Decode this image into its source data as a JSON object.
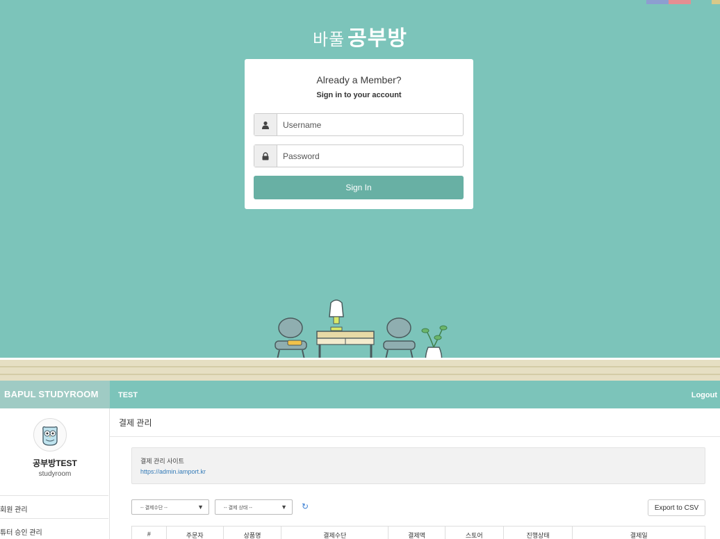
{
  "login": {
    "brand_prefix": "바풀",
    "brand_main": "공부방",
    "heading": "Already a Member?",
    "subheading": "Sign in to your account",
    "username_placeholder": "Username",
    "password_placeholder": "Password",
    "signin_label": "Sign In"
  },
  "colors": {
    "scene_bg": "#7cc4ba",
    "button_bg": "#68b0a4",
    "swatch_1": "#8d9ed0",
    "swatch_2": "#e58e92",
    "swatch_3": "#d9c989"
  },
  "admin": {
    "brand": "BAPUL STUDYROOM",
    "breadcrumb": "TEST",
    "logout": "Logout",
    "profile_name": "공부방TEST",
    "profile_sub": "studyroom",
    "sidebar_items": [
      {
        "label": "회원 관리"
      },
      {
        "label": "튜터 승인 관리"
      }
    ],
    "page_title": "결제 관리",
    "notice_title": "결제 관리 사이트",
    "notice_link": "https://admin.iamport.kr",
    "filter_method": "-- 결제수단 --",
    "filter_status": "-- 결제 상태 --",
    "export_label": "Export to CSV",
    "columns": [
      "#",
      "주문자",
      "상품명",
      "결제수단",
      "결제액",
      "스토어",
      "진행상태",
      "결제일"
    ]
  }
}
